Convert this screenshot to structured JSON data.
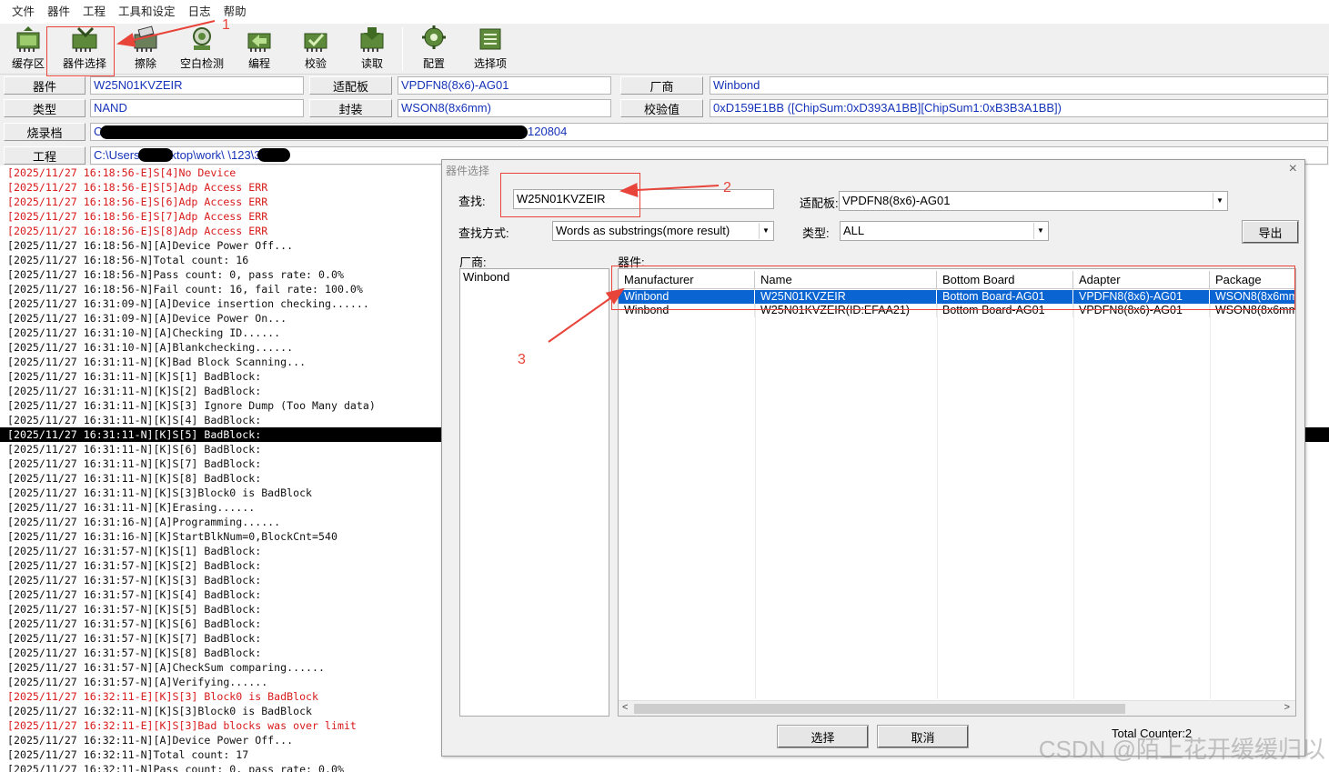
{
  "menu": [
    "文件",
    "器件",
    "工程",
    "工具和设定",
    "日志",
    "帮助"
  ],
  "toolbar": [
    {
      "label": "缓存区",
      "icon": "buffer-chip-icon"
    },
    {
      "label": "器件选择",
      "icon": "device-select-chip-icon"
    },
    {
      "label": "擦除",
      "icon": "erase-chip-icon"
    },
    {
      "label": "空白检测",
      "icon": "blank-check-icon"
    },
    {
      "label": "编程",
      "icon": "program-chip-icon"
    },
    {
      "label": "校验",
      "icon": "verify-chip-icon"
    },
    {
      "label": "读取",
      "icon": "read-chip-icon"
    },
    {
      "label": "配置",
      "icon": "config-gear-icon"
    },
    {
      "label": "选择项",
      "icon": "options-icon"
    }
  ],
  "info": {
    "device_label": "器件",
    "device": "W25N01KVZEIR",
    "adapter_label": "适配板",
    "adapter": "VPDFN8(8x6)-AG01",
    "vendor_label": "厂商",
    "vendor": "Winbond",
    "type_label": "类型",
    "type": "NAND",
    "package_label": "封装",
    "package": "WSON8(8x6mm)",
    "checksum_label": "校验值",
    "checksum": "0xD159E1BB    ([ChipSum:0xD393A1BB][ChipSum1:0xB3B3A1BB])",
    "image_label": "烧录档",
    "image_path_head": "C:\\",
    "image_path_tail": "120804",
    "project_label": "工程",
    "project_path": "C:\\Users\\       \\Desktop\\work\\       \\123\\3.apr"
  },
  "log": [
    {
      "t": "[2025/11/27 16:18:56-E]S[4]No Device",
      "err": true
    },
    {
      "t": "[2025/11/27 16:18:56-E]S[5]Adp Access ERR",
      "err": true
    },
    {
      "t": "[2025/11/27 16:18:56-E]S[6]Adp Access ERR",
      "err": true
    },
    {
      "t": "[2025/11/27 16:18:56-E]S[7]Adp Access ERR",
      "err": true
    },
    {
      "t": "[2025/11/27 16:18:56-E]S[8]Adp Access ERR",
      "err": true
    },
    {
      "t": "[2025/11/27 16:18:56-N][A]Device Power Off..."
    },
    {
      "t": "[2025/11/27 16:18:56-N]Total count: 16"
    },
    {
      "t": "[2025/11/27 16:18:56-N]Pass count: 0, pass rate: 0.0%"
    },
    {
      "t": "[2025/11/27 16:18:56-N]Fail count: 16, fail rate: 100.0%"
    },
    {
      "t": "[2025/11/27 16:31:09-N][A]Device insertion checking......"
    },
    {
      "t": "[2025/11/27 16:31:09-N][A]Device Power On..."
    },
    {
      "t": "[2025/11/27 16:31:10-N][A]Checking ID......"
    },
    {
      "t": "[2025/11/27 16:31:10-N][A]Blankchecking......"
    },
    {
      "t": "[2025/11/27 16:31:11-N][K]Bad Block Scanning..."
    },
    {
      "t": "[2025/11/27 16:31:11-N][K]S[1] BadBlock:"
    },
    {
      "t": "[2025/11/27 16:31:11-N][K]S[2] BadBlock:"
    },
    {
      "t": "[2025/11/27 16:31:11-N][K]S[3] Ignore Dump (Too Many data)"
    },
    {
      "t": "[2025/11/27 16:31:11-N][K]S[4] BadBlock:"
    },
    {
      "t": "[2025/11/27 16:31:11-N][K]S[5] BadBlock:",
      "sel": true
    },
    {
      "t": "[2025/11/27 16:31:11-N][K]S[6] BadBlock:"
    },
    {
      "t": "[2025/11/27 16:31:11-N][K]S[7] BadBlock:"
    },
    {
      "t": "[2025/11/27 16:31:11-N][K]S[8] BadBlock:"
    },
    {
      "t": "[2025/11/27 16:31:11-N][K]S[3]Block0 is BadBlock"
    },
    {
      "t": "[2025/11/27 16:31:11-N][K]Erasing......"
    },
    {
      "t": "[2025/11/27 16:31:16-N][A]Programming......"
    },
    {
      "t": "[2025/11/27 16:31:16-N][K]StartBlkNum=0,BlockCnt=540"
    },
    {
      "t": "[2025/11/27 16:31:57-N][K]S[1] BadBlock:"
    },
    {
      "t": "[2025/11/27 16:31:57-N][K]S[2] BadBlock:"
    },
    {
      "t": "[2025/11/27 16:31:57-N][K]S[3] BadBlock:"
    },
    {
      "t": "[2025/11/27 16:31:57-N][K]S[4] BadBlock:"
    },
    {
      "t": "[2025/11/27 16:31:57-N][K]S[5] BadBlock:"
    },
    {
      "t": "[2025/11/27 16:31:57-N][K]S[6] BadBlock:"
    },
    {
      "t": "[2025/11/27 16:31:57-N][K]S[7] BadBlock:"
    },
    {
      "t": "[2025/11/27 16:31:57-N][K]S[8] BadBlock:"
    },
    {
      "t": "[2025/11/27 16:31:57-N][A]CheckSum comparing......"
    },
    {
      "t": "[2025/11/27 16:31:57-N][A]Verifying......"
    },
    {
      "t": "[2025/11/27 16:32:11-E][K]S[3] Block0 is BadBlock",
      "err": true
    },
    {
      "t": "[2025/11/27 16:32:11-N][K]S[3]Block0 is BadBlock"
    },
    {
      "t": "[2025/11/27 16:32:11-E][K]S[3]Bad blocks was over limit",
      "err": true
    },
    {
      "t": "[2025/11/27 16:32:11-N][A]Device Power Off..."
    },
    {
      "t": "[2025/11/27 16:32:11-N]Total count: 17"
    },
    {
      "t": "[2025/11/27 16:32:11-N]Pass count: 0, pass rate: 0.0%"
    }
  ],
  "dialog": {
    "title": "器件选择",
    "close": "×",
    "search_label": "查找:",
    "search_value": "W25N01KVZEIR",
    "adapter_label": "适配板:",
    "adapter_value": "VPDFN8(8x6)-AG01",
    "mode_label": "查找方式:",
    "mode_value": "Words as substrings(more result)",
    "type_label": "类型:",
    "type_value": "ALL",
    "export_button": "导出",
    "vendor_list_label": "厂商:",
    "vendors": [
      "Winbond"
    ],
    "device_list_label": "器件:",
    "columns": [
      "Manufacturer",
      "Name",
      "Bottom Board",
      "Adapter",
      "Package"
    ],
    "rows": [
      [
        "Winbond",
        "W25N01KVZEIR",
        "Bottom Board-AG01",
        "VPDFN8(8x6)-AG01",
        "WSON8(8x6mm)"
      ],
      [
        "Winbond",
        "W25N01KVZEIR(ID:EFAA21)",
        "Bottom Board-AG01",
        "VPDFN8(8x6)-AG01",
        "WSON8(8x6mm)"
      ]
    ],
    "scroll_left": "<",
    "scroll_right": ">",
    "select_button": "选择",
    "cancel_button": "取消",
    "total_counter": "Total Counter:2"
  },
  "annotations": [
    "1",
    "2",
    "3"
  ],
  "watermark": "CSDN @陌上花开缓缓归以",
  "colors": {
    "annotation": "#e8443a",
    "error_text": "#d81b1b",
    "info_text": "#1533b8",
    "selection": "#0a64d2"
  }
}
